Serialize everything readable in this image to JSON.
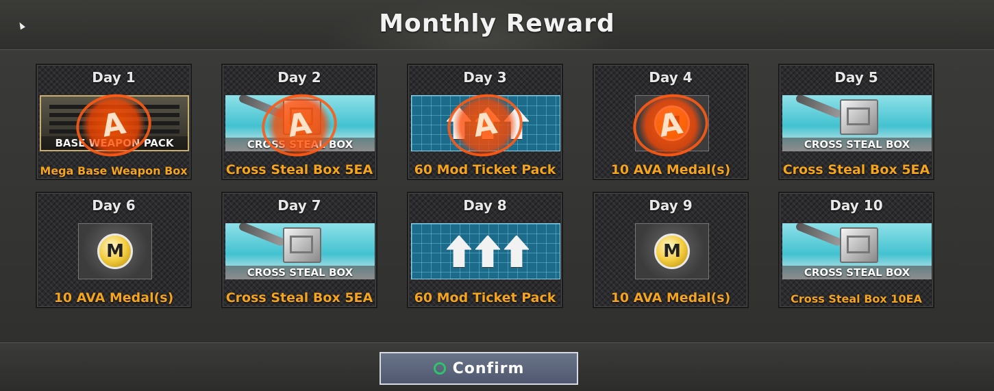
{
  "dialog": {
    "title": "Monthly Reward",
    "confirm_label": "Confirm"
  },
  "rewards": [
    {
      "day": "Day 1",
      "name": "Mega Base Weapon Box",
      "image_label": "BASE WEAPON PACK",
      "claimed": true
    },
    {
      "day": "Day 2",
      "name": "Cross Steal Box 5EA",
      "image_label": "CROSS STEAL BOX",
      "claimed": true
    },
    {
      "day": "Day 3",
      "name": "60 Mod Ticket Pack",
      "claimed": true
    },
    {
      "day": "Day 4",
      "name": "10 AVA Medal(s)",
      "claimed": true
    },
    {
      "day": "Day 5",
      "name": "Cross Steal Box 5EA",
      "image_label": "CROSS STEAL BOX",
      "claimed": false
    },
    {
      "day": "Day 6",
      "name": "10 AVA Medal(s)",
      "claimed": false
    },
    {
      "day": "Day 7",
      "name": "Cross Steal Box 5EA",
      "image_label": "CROSS STEAL BOX",
      "claimed": false
    },
    {
      "day": "Day 8",
      "name": "60 Mod Ticket Pack",
      "claimed": false
    },
    {
      "day": "Day 9",
      "name": "10 AVA Medal(s)",
      "claimed": false
    },
    {
      "day": "Day 10",
      "name": "Cross Steal Box 10EA",
      "image_label": "CROSS STEAL BOX",
      "claimed": false
    }
  ],
  "icons": {
    "claimed_stamp": "claimed-stamp-icon",
    "medal": "ava-medal-icon",
    "confirm": "circle-button-icon"
  },
  "colors": {
    "reward_name": "#f4a51c",
    "stamp": "#ff5a14",
    "confirm_ring": "#2ec46a"
  }
}
